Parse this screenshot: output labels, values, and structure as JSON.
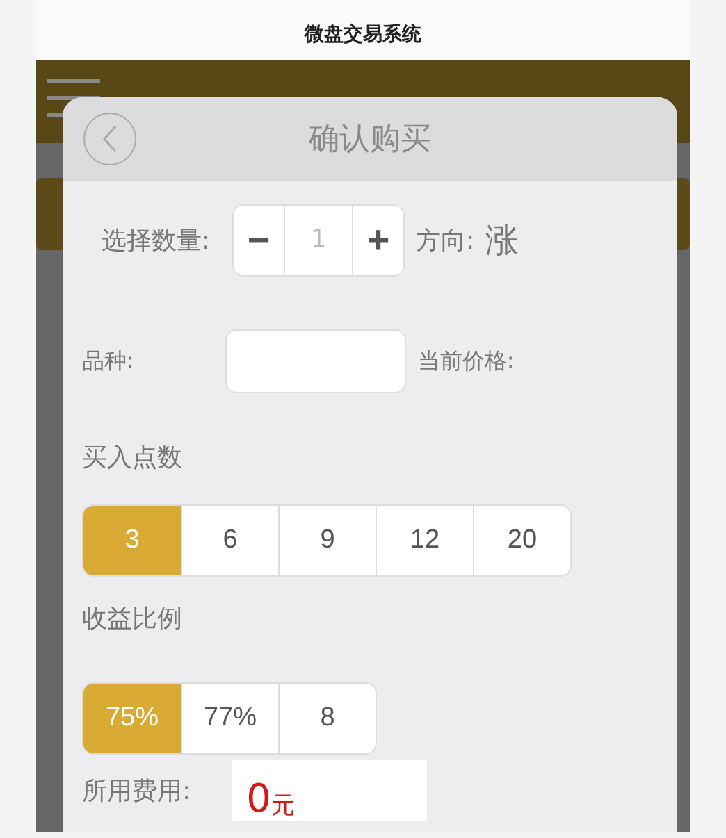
{
  "window": {
    "title": "微盘交易系统"
  },
  "dialog": {
    "title": "确认购买",
    "quantity": {
      "label": "选择数量:",
      "minus": "−",
      "value": "1",
      "plus": "+"
    },
    "direction": {
      "label": "方向:",
      "value": "涨"
    },
    "product": {
      "label": "品种:",
      "price_label": "当前价格:"
    },
    "points": {
      "label": "买入点数",
      "options": [
        {
          "label": "3",
          "selected": true
        },
        {
          "label": "6",
          "selected": false
        },
        {
          "label": "9",
          "selected": false
        },
        {
          "label": "12",
          "selected": false
        },
        {
          "label": "20",
          "selected": false
        }
      ]
    },
    "ratio": {
      "label": "收益比例",
      "options": [
        {
          "label": "75%",
          "selected": true
        },
        {
          "label": "77%",
          "selected": false
        },
        {
          "label": "8",
          "selected": false
        }
      ]
    },
    "cost": {
      "label": "所用费用:",
      "amount": "0",
      "unit": "元"
    }
  }
}
